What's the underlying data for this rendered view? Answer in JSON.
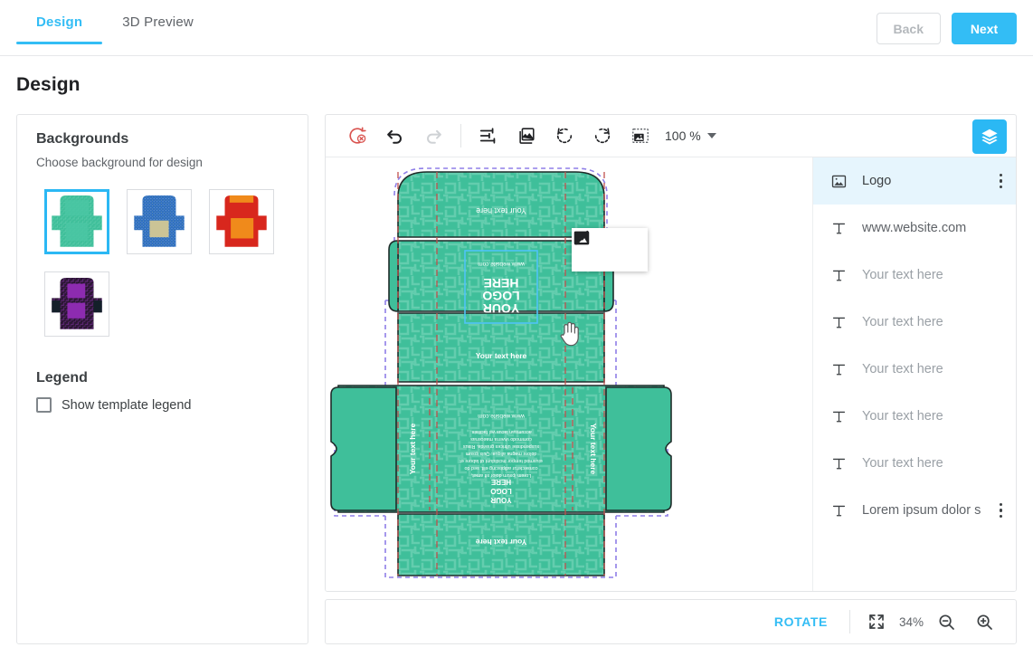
{
  "header": {
    "tabs": [
      {
        "label": "Design",
        "active": true
      },
      {
        "label": "3D Preview",
        "active": false
      }
    ],
    "back_label": "Back",
    "next_label": "Next"
  },
  "page_title": "Design",
  "sidebar": {
    "backgrounds_title": "Backgrounds",
    "backgrounds_subtitle": "Choose background for design",
    "thumbnails": [
      {
        "name": "green-maze-background",
        "selected": true,
        "base": "#3fbf9a",
        "accent": "#4ac5a3",
        "pattern": "#35b492"
      },
      {
        "name": "blue-speckle-background",
        "selected": false,
        "base": "#2f6fc0",
        "accent": "#cbc496",
        "pattern": "#5a93d8"
      },
      {
        "name": "red-orange-background",
        "selected": false,
        "base": "#d8271d",
        "accent": "#f08a1b",
        "pattern": "#e24a2c"
      },
      {
        "name": "purple-dark-background",
        "selected": false,
        "base": "#2b1733",
        "accent": "#8d2bb0",
        "pattern": "#6a2a85"
      }
    ],
    "legend_title": "Legend",
    "legend_checkbox_label": "Show template legend",
    "legend_checked": false
  },
  "toolbar": {
    "reset_icon": "reset-clear-icon",
    "undo_icon": "undo-icon",
    "redo_icon": "redo-icon",
    "adjust_icon": "adjust-sliders-icon",
    "images_icon": "images-icon",
    "rotate_left_icon": "rotate-left-icon",
    "rotate_right_icon": "rotate-right-icon",
    "image_fit_icon": "image-fit-icon",
    "zoom_value": "100 %",
    "layers_toggle_icon": "layers-stack-icon"
  },
  "float_tools": {
    "image_icon": "image-icon",
    "edit_icon": "pencil-edit-icon"
  },
  "layers": {
    "items": [
      {
        "icon": "image-layer-icon",
        "label": "Logo",
        "active": true,
        "placeholder": false,
        "menu": true
      },
      {
        "icon": "text-layer-icon",
        "label": "www.website.com",
        "active": false,
        "placeholder": false,
        "menu": false
      },
      {
        "icon": "text-layer-icon",
        "label": "Your text here",
        "active": false,
        "placeholder": true,
        "menu": false
      },
      {
        "icon": "text-layer-icon",
        "label": "Your text here",
        "active": false,
        "placeholder": true,
        "menu": false
      },
      {
        "icon": "text-layer-icon",
        "label": "Your text here",
        "active": false,
        "placeholder": true,
        "menu": false
      },
      {
        "icon": "text-layer-icon",
        "label": "Your text here",
        "active": false,
        "placeholder": true,
        "menu": false
      },
      {
        "icon": "text-layer-icon",
        "label": "Your text here",
        "active": false,
        "placeholder": true,
        "menu": false
      },
      {
        "icon": "text-layer-icon",
        "label": "Lorem ipsum dolor sit a…",
        "active": false,
        "placeholder": false,
        "menu": true
      }
    ]
  },
  "bottom": {
    "rotate_label": "ROTATE",
    "fit_icon": "fit-to-screen-icon",
    "zoom_percent": "34%",
    "zoom_out_icon": "zoom-out-icon",
    "zoom_in_icon": "zoom-in-icon"
  },
  "canvas": {
    "dieline": {
      "fill": "#3fbf9a",
      "cut_line": "#1f2c2a",
      "bleed_line": "#8f7fe8",
      "fold_line": "#c0504d",
      "selection_box": "#4fc3f7"
    },
    "texts": {
      "top_flap": "Your text here",
      "front_website": "www.website.com",
      "front_logo": "YOUR\nLOGO\nHERE",
      "mid_panel": "Your text here",
      "back_website": "www.website.com",
      "back_body": "Lorem ipsum dolor sit amet, consectetur adipiscing elit, sed do eiusmod tempor incididunt ut labore et dolore magna aliqua. Quis ipsum suspendisse ultrices gravida. Risus commodo viverra maecenas accumsan lacus vel facilisis.",
      "back_logo": "YOUR\nLOGO\nHERE",
      "left_side": "Your text here",
      "right_side": "Your text here",
      "bottom_flap": "Your text here"
    }
  }
}
